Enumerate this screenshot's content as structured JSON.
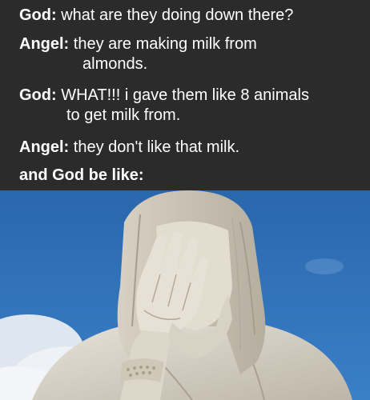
{
  "dialogue": [
    {
      "speaker": "God:",
      "text": "what are they doing down there?"
    },
    {
      "speaker": "Angel:",
      "text": "they are making milk from",
      "cont": "almonds."
    },
    {
      "speaker": "God:",
      "text": "WHAT!!! i gave them like 8 animals",
      "cont": "to get milk from."
    },
    {
      "speaker": "Angel:",
      "text": "they don't like that milk."
    }
  ],
  "punchline": "and God be like:",
  "photo": {
    "subject": "statue-facepalm",
    "sky_color": "#2f6db3",
    "stone_color": "#d9d4c8"
  }
}
